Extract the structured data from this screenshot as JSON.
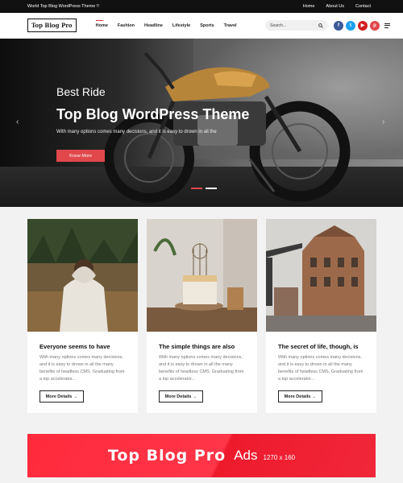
{
  "topbar": {
    "title": "World Top Blog WordPress Theme !!",
    "links": [
      "Home",
      "About Us",
      "Contact"
    ]
  },
  "header": {
    "logo": "Top Blog Pro",
    "nav": [
      "Home",
      "Fashion",
      "Headline",
      "Lifestyle",
      "Sports",
      "Travel"
    ],
    "search_placeholder": "Search...",
    "socials": [
      {
        "icon": "facebook-icon",
        "glyph": "f",
        "color": "#3b5998"
      },
      {
        "icon": "twitter-icon",
        "glyph": "t",
        "color": "#1da1f2"
      },
      {
        "icon": "youtube-icon",
        "glyph": "▶",
        "color": "#d21f1f"
      },
      {
        "icon": "pinterest-icon",
        "glyph": "p",
        "color": "#e0484b"
      }
    ]
  },
  "hero": {
    "subtitle": "Best Ride",
    "title": "Top Blog WordPress Theme",
    "description": "With many options comes many decisions, and it is easy to drown in all the",
    "button": "Know More",
    "prev_glyph": "‹",
    "next_glyph": "›",
    "active_slide": 1,
    "slide_count": 2
  },
  "cards": [
    {
      "title": "Everyone seems to have",
      "text": "With many options comes many decisions, and it is easy to drown in all the many benefits of headless CMS. Graduating from a top accelerator...",
      "button": "More Details"
    },
    {
      "title": "The simple things are also",
      "text": "With many options comes many decisions, and it is easy to drown in all the many benefits of headless CMS. Graduating from a top accelerator...",
      "button": "More Details"
    },
    {
      "title": "The secret of life, though, is",
      "text": "With many options comes many decisions, and it is easy to drown in all the many benefits of headless CMS. Graduating from a top accelerator...",
      "button": "More Details"
    }
  ],
  "ad": {
    "brand": "Top Blog Pro",
    "word": "Ads",
    "size": "1270 x 160"
  },
  "colors": {
    "accent": "#e0484b",
    "ad_bg": "#ff2a3c"
  }
}
